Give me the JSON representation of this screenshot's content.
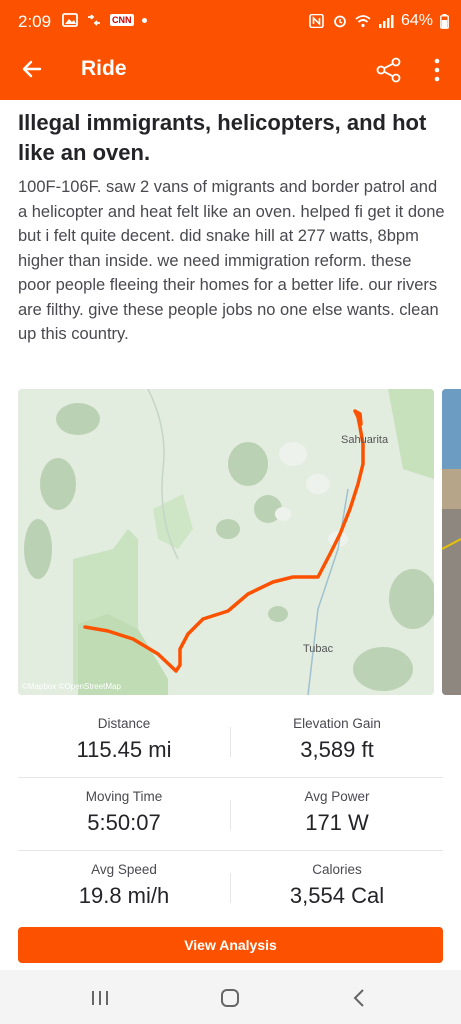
{
  "status_bar": {
    "time": "2:09",
    "battery": "64%",
    "notification_badge": "CNN"
  },
  "app_bar": {
    "title": "Ride",
    "back_icon": "arrow-left-icon",
    "share_icon": "share-icon",
    "more_icon": "more-vertical-icon"
  },
  "activity": {
    "title": "Illegal immigrants, helicopters, and hot like an oven.",
    "description": "100F-106F. saw 2 vans of migrants and border patrol and a helicopter and heat felt like an oven. helped fi get it done but i felt quite decent. did snake hill at 277 watts, 8bpm higher than inside. we need immigration reform. these poor people fleeing their homes for a better life. our rivers are filthy. give these people jobs no one else wants. clean up this country."
  },
  "map": {
    "label_town_1": "Sahuarita",
    "label_town_2": "Tubac",
    "attribution": "©Mapbox ©OpenStreetMap",
    "route_color": "#fc5200"
  },
  "stats": [
    {
      "label": "Distance",
      "value": "115.45 mi"
    },
    {
      "label": "Elevation Gain",
      "value": "3,589 ft"
    },
    {
      "label": "Moving Time",
      "value": "5:50:07"
    },
    {
      "label": "Avg Power",
      "value": "171 W"
    },
    {
      "label": "Avg Speed",
      "value": "19.8 mi/h"
    },
    {
      "label": "Calories",
      "value": "3,554 Cal"
    }
  ],
  "actions": {
    "view_analysis": "View Analysis"
  },
  "colors": {
    "brand": "#fc5200",
    "text_primary": "#242428",
    "text_secondary": "#494950"
  }
}
